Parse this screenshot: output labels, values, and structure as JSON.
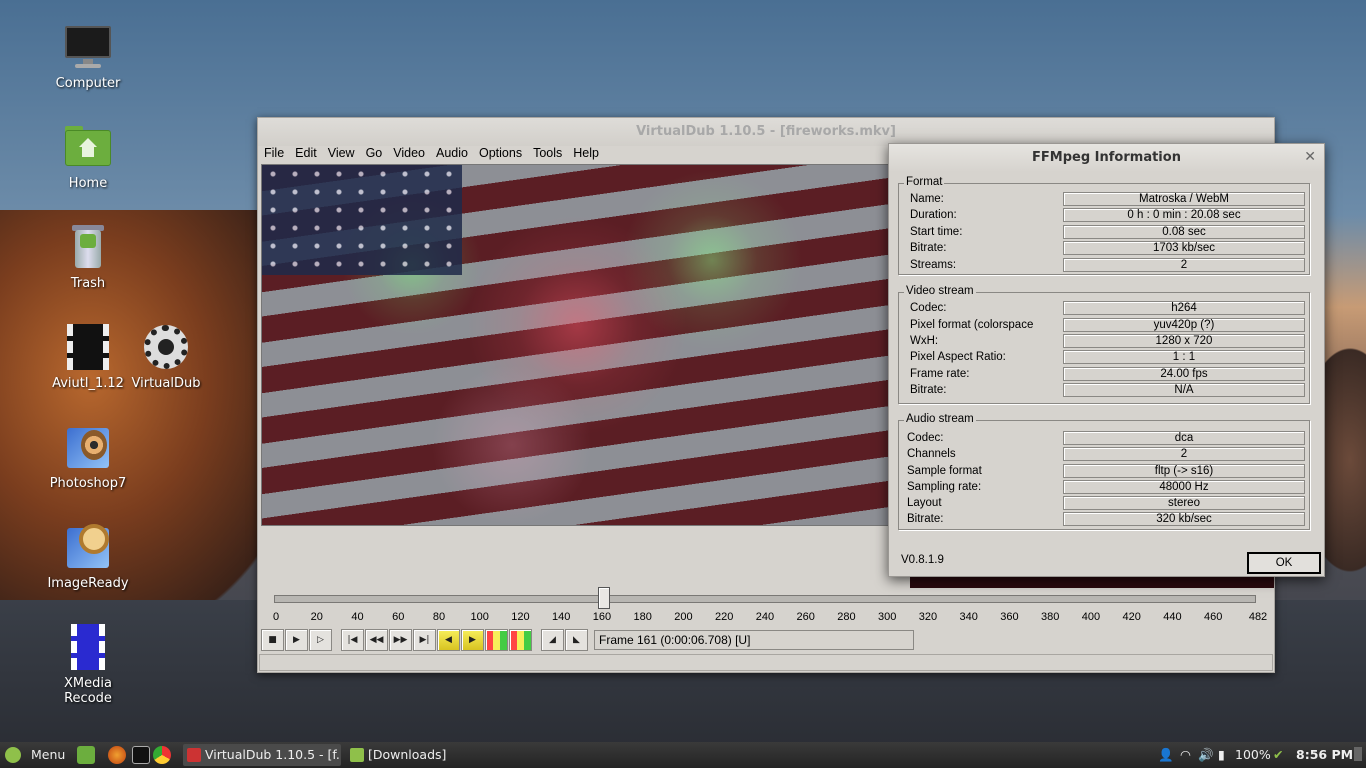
{
  "desktop": {
    "icons": [
      {
        "label": "Computer",
        "icon": "computer-icon"
      },
      {
        "label": "Home",
        "icon": "home-folder-icon"
      },
      {
        "label": "Trash",
        "icon": "trash-icon"
      },
      {
        "label": "Aviutl_1.12",
        "icon": "film-strip-icon"
      },
      {
        "label": "VirtualDub",
        "icon": "gear-film-icon"
      },
      {
        "label": "Photoshop7",
        "icon": "photoshop-eye-icon"
      },
      {
        "label": "ImageReady",
        "icon": "imageready-icon"
      },
      {
        "label": "XMedia Recode",
        "icon": "film-strip-icon"
      }
    ]
  },
  "vdub": {
    "title": "VirtualDub 1.10.5 - [fireworks.mkv]",
    "menu": [
      "File",
      "Edit",
      "View",
      "Go",
      "Video",
      "Audio",
      "Options",
      "Tools",
      "Help"
    ],
    "timeline": {
      "ticks": [
        "0",
        "20",
        "40",
        "60",
        "80",
        "100",
        "120",
        "140",
        "160",
        "180",
        "200",
        "220",
        "240",
        "260",
        "280",
        "300",
        "320",
        "340",
        "360",
        "380",
        "400",
        "420",
        "440",
        "460",
        "482"
      ],
      "position": 161,
      "total": 482
    },
    "frame_text": "Frame 161 (0:00:06.708) [U]"
  },
  "ffmpeg": {
    "title": "FFMpeg Information",
    "format": {
      "label": "Format",
      "rows": [
        {
          "k": "Name:",
          "v": "Matroska / WebM"
        },
        {
          "k": "Duration:",
          "v": "0 h : 0 min : 20.08 sec"
        },
        {
          "k": "Start time:",
          "v": "0.08 sec"
        },
        {
          "k": "Bitrate:",
          "v": "1703 kb/sec"
        },
        {
          "k": "Streams:",
          "v": "2"
        }
      ]
    },
    "video": {
      "label": "Video stream",
      "rows": [
        {
          "k": "Codec:",
          "v": "h264"
        },
        {
          "k": "Pixel format (colorspace",
          "v": "yuv420p (?)"
        },
        {
          "k": "WxH:",
          "v": "1280 x 720"
        },
        {
          "k": "Pixel Aspect Ratio:",
          "v": "1 : 1"
        },
        {
          "k": "Frame rate:",
          "v": "24.00 fps"
        },
        {
          "k": "Bitrate:",
          "v": "N/A"
        }
      ]
    },
    "audio": {
      "label": "Audio stream",
      "rows": [
        {
          "k": "Codec:",
          "v": "dca"
        },
        {
          "k": "Channels",
          "v": "2"
        },
        {
          "k": "Sample format",
          "v": "fltp (-> s16)"
        },
        {
          "k": "Sampling rate:",
          "v": "48000 Hz"
        },
        {
          "k": "Layout",
          "v": "stereo"
        },
        {
          "k": "Bitrate:",
          "v": "320 kb/sec"
        }
      ]
    },
    "version": "V0.8.1.9",
    "ok_label": "OK"
  },
  "taskbar": {
    "menu_label": "Menu",
    "tasks": [
      "VirtualDub 1.10.5 - [f...",
      "[Downloads]"
    ],
    "battery": "100%",
    "clock": "8:56 PM"
  }
}
